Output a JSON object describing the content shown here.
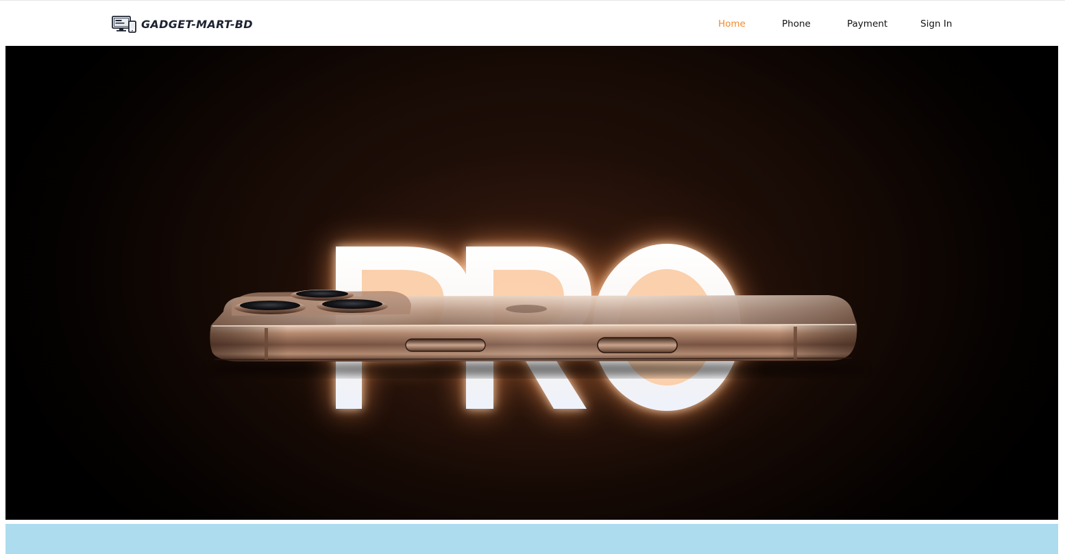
{
  "brand": {
    "name": "GADGET-MART-BD",
    "logo_icon": "devices-icon"
  },
  "nav": {
    "items": [
      {
        "label": "Home",
        "active": true
      },
      {
        "label": "Phone",
        "active": false
      },
      {
        "label": "Payment",
        "active": false
      },
      {
        "label": "Sign In",
        "active": false
      }
    ]
  },
  "hero": {
    "headline_image_text": "PRO"
  },
  "colors": {
    "accent_active_nav": "#f08a2c",
    "brand_text": "#1c2230",
    "hero_background": "#000000",
    "strip_background": "#aedcef"
  }
}
